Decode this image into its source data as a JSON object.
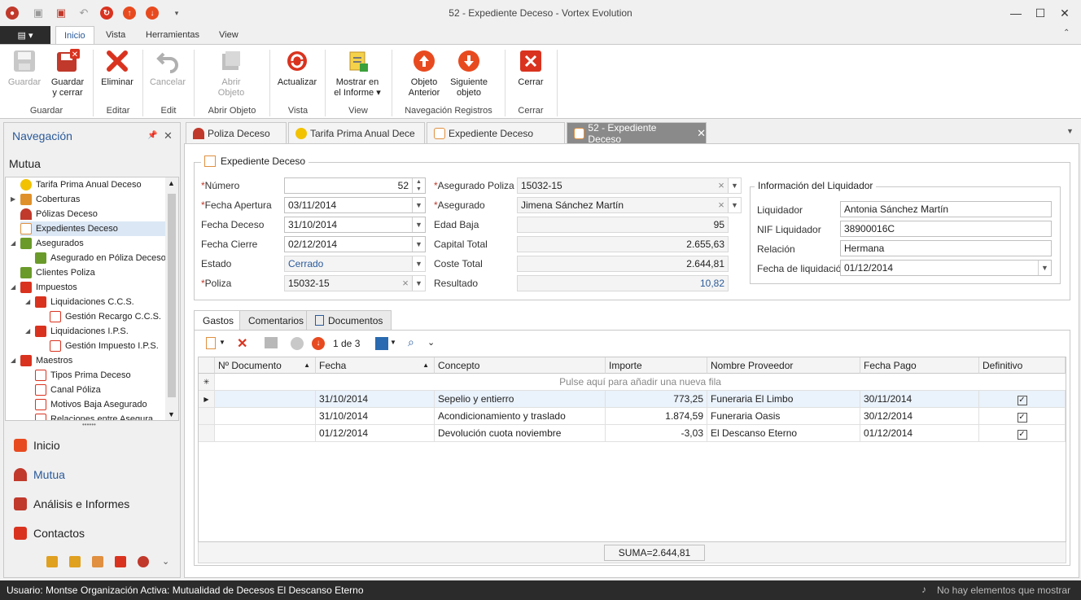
{
  "window": {
    "title": "52 - Expediente Deceso - Vortex Evolution"
  },
  "ribbon_tabs": [
    "Inicio",
    "Vista",
    "Herramientas",
    "View"
  ],
  "ribbon": {
    "guardar": "Guardar",
    "guardar_cerrar": [
      "Guardar",
      "y cerrar"
    ],
    "eliminar": "Eliminar",
    "cancelar": "Cancelar",
    "abrir": [
      "Abrir",
      "Objeto"
    ],
    "actualizar": "Actualizar",
    "mostrar": [
      "Mostrar en",
      "el Informe"
    ],
    "obj_anterior": [
      "Objeto",
      "Anterior"
    ],
    "sig_objeto": [
      "Siguiente",
      "objeto"
    ],
    "cerrar": "Cerrar",
    "groups": {
      "guardar": "Guardar",
      "editar": "Editar",
      "edit": "Edit",
      "abrir": "Abrir Objeto",
      "vista": "Vista",
      "view": "View",
      "nav": "Navegación Registros",
      "cerrar": "Cerrar"
    }
  },
  "nav": {
    "header": "Navegación",
    "section": "Mutua",
    "tree": [
      {
        "label": "Tarifa Prima Anual Deceso",
        "color": "#f2c200"
      },
      {
        "label": "Coberturas",
        "color": "#e0902a"
      },
      {
        "label": "Pólizas Deceso",
        "color": "#c0392b"
      },
      {
        "label": "Expedientes Deceso",
        "color": "#e8c08a"
      },
      {
        "label": "Asegurados",
        "color": "#6a9a2a"
      },
      {
        "label": "Asegurado en Póliza Deceso",
        "color": "#6a9a2a"
      },
      {
        "label": "Clientes Poliza",
        "color": "#6a9a2a"
      },
      {
        "label": "Impuestos",
        "color": "#d9331f"
      },
      {
        "label": "Liquidaciones C.C.S.",
        "color": "#d9331f"
      },
      {
        "label": "Gestión Recargo C.C.S.",
        "color": "#d9331f"
      },
      {
        "label": "Liquidaciones I.P.S.",
        "color": "#d9331f"
      },
      {
        "label": "Gestión Impuesto I.P.S.",
        "color": "#d9331f"
      },
      {
        "label": "Maestros",
        "color": "#d9331f"
      },
      {
        "label": "Tipos Prima Deceso",
        "color": "#d9331f"
      },
      {
        "label": "Canal Póliza",
        "color": "#d9331f"
      },
      {
        "label": "Motivos Baja Asegurado",
        "color": "#d9331f"
      },
      {
        "label": "Relaciones entre Asegura...",
        "color": "#d9331f"
      }
    ],
    "links": [
      "Inicio",
      "Mutua",
      "Análisis e Informes",
      "Contactos"
    ]
  },
  "doc_tabs": [
    "Poliza Deceso",
    "Tarifa Prima Anual Dece",
    "Expediente Deceso",
    "52 - Expediente Deceso"
  ],
  "form": {
    "group_title": "Expediente Deceso",
    "numero_lbl": "Número",
    "numero": "52",
    "fecha_apertura_lbl": "Fecha Apertura",
    "fecha_apertura": "03/11/2014",
    "fecha_deceso_lbl": "Fecha Deceso",
    "fecha_deceso": "31/10/2014",
    "fecha_cierre_lbl": "Fecha Cierre",
    "fecha_cierre": "02/12/2014",
    "estado_lbl": "Estado",
    "estado": "Cerrado",
    "poliza_lbl": "Poliza",
    "poliza": "15032-15",
    "aseg_poliza_lbl": "Asegurado Poliza",
    "aseg_poliza": "15032-15",
    "asegurado_lbl": "Asegurado",
    "asegurado": "Jimena Sánchez Martín",
    "edad_baja_lbl": "Edad Baja",
    "edad_baja": "95",
    "capital_lbl": "Capital Total",
    "capital": "2.655,63",
    "coste_lbl": "Coste Total",
    "coste": "2.644,81",
    "resultado_lbl": "Resultado",
    "resultado": "10,82",
    "liq_title": "Información del Liquidador",
    "liquidador_lbl": "Liquidador",
    "liquidador": "Antonia Sánchez Martín",
    "nif_lbl": "NIF Liquidador",
    "nif": "38900016C",
    "relacion_lbl": "Relación",
    "relacion": "Hermana",
    "fecha_liq_lbl": "Fecha de liquidación",
    "fecha_liq": "01/12/2014"
  },
  "sub_tabs": [
    "Gastos",
    "Comentarios",
    "Documentos"
  ],
  "grid": {
    "pager": "1 de 3",
    "columns": [
      "Nº Documento",
      "Fecha",
      "Concepto",
      "Importe",
      "Nombre Proveedor",
      "Fecha Pago",
      "Definitivo"
    ],
    "new_row": "Pulse aquí para añadir una nueva fila",
    "rows": [
      {
        "doc": "",
        "fecha": "31/10/2014",
        "concepto": "Sepelio y entierro",
        "importe": "773,25",
        "proveedor": "Funeraria El Limbo",
        "pago": "30/11/2014",
        "def": "✓"
      },
      {
        "doc": "",
        "fecha": "31/10/2014",
        "concepto": "Acondicionamiento y traslado",
        "importe": "1.874,59",
        "proveedor": "Funeraria Oasis",
        "pago": "30/12/2014",
        "def": "✓"
      },
      {
        "doc": "",
        "fecha": "01/12/2014",
        "concepto": "Devolución cuota noviembre",
        "importe": "-3,03",
        "proveedor": "El Descanso Eterno",
        "pago": "01/12/2014",
        "def": "✓"
      }
    ],
    "footer_sum": "SUMA=2.644,81"
  },
  "status": {
    "user": "Usuario: Montse",
    "org": "Organización Activa: Mutualidad de Decesos El Descanso Eterno",
    "notif": "No hay elementos que mostrar"
  }
}
